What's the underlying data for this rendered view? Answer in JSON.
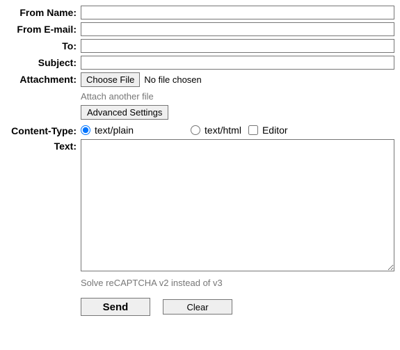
{
  "labels": {
    "from_name": "From Name:",
    "from_email": "From E-mail:",
    "to": "To:",
    "subject": "Subject:",
    "attachment": "Attachment:",
    "content_type": "Content-Type:",
    "text": "Text:"
  },
  "fields": {
    "from_name": "",
    "from_email": "",
    "to": "",
    "subject": "",
    "text": ""
  },
  "attachment": {
    "choose_button": "Choose File",
    "status": "No file chosen",
    "another_link": "Attach another file",
    "advanced_button": "Advanced Settings"
  },
  "content_type": {
    "plain_label": "text/plain",
    "html_label": "text/html",
    "editor_label": "Editor",
    "selected": "plain",
    "editor_checked": false
  },
  "captcha_link": "Solve reCAPTCHA v2 instead of v3",
  "buttons": {
    "send": "Send",
    "clear": "Clear"
  }
}
